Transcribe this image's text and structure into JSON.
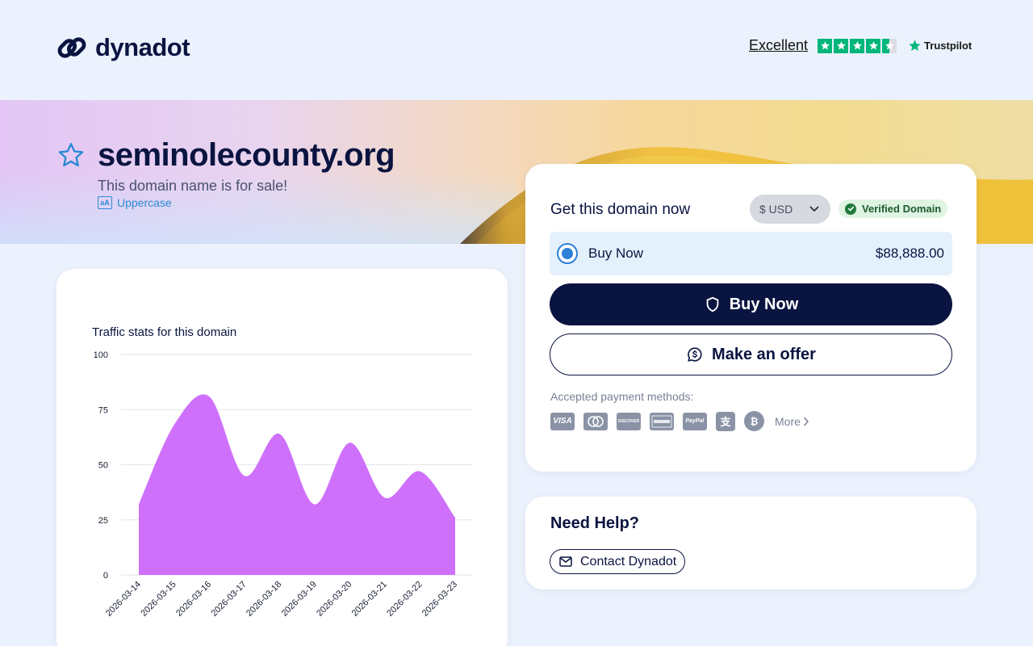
{
  "header": {
    "brand": "dynadot",
    "rating_label": "Excellent",
    "rating_brand": "Trustpilot",
    "rating_stars": 4.5
  },
  "hero": {
    "domain": "seminolecounty.org",
    "subtitle": "This domain name is for sale!",
    "uppercase_label": "Uppercase",
    "uppercase_icon_text": "aA"
  },
  "purchase": {
    "title": "Get this domain now",
    "currency": "$ USD",
    "verified_label": "Verified Domain",
    "option_label": "Buy Now",
    "option_price": "$88,888.00",
    "buy_button": "Buy Now",
    "offer_button": "Make an offer",
    "payment_label": "Accepted payment methods:",
    "payment_methods": [
      "VISA",
      "Mastercard",
      "DISCOVER",
      "American Express",
      "PayPal",
      "Alipay",
      "Bitcoin"
    ],
    "more_label": "More"
  },
  "help": {
    "title": "Need Help?",
    "contact_label": "Contact Dynadot"
  },
  "colors": {
    "navy": "#0a1440",
    "chart_fill": "#cf70fb",
    "trustpilot_green": "#00b67a",
    "verified_green": "#1f7a3c",
    "link_blue": "#2d8ad6"
  },
  "chart_data": {
    "type": "area",
    "title": "Traffic stats for this domain",
    "x": [
      "2026-03-14",
      "2026-03-15",
      "2026-03-16",
      "2026-03-17",
      "2026-03-18",
      "2026-03-19",
      "2026-03-20",
      "2026-03-21",
      "2026-03-22",
      "2026-03-23"
    ],
    "values": [
      32,
      68,
      81,
      45,
      64,
      32,
      60,
      35,
      47,
      26
    ],
    "ylim": [
      0,
      100
    ],
    "yticks": [
      0,
      25,
      50,
      75,
      100
    ],
    "grid": true,
    "xlabel": "",
    "ylabel": ""
  }
}
